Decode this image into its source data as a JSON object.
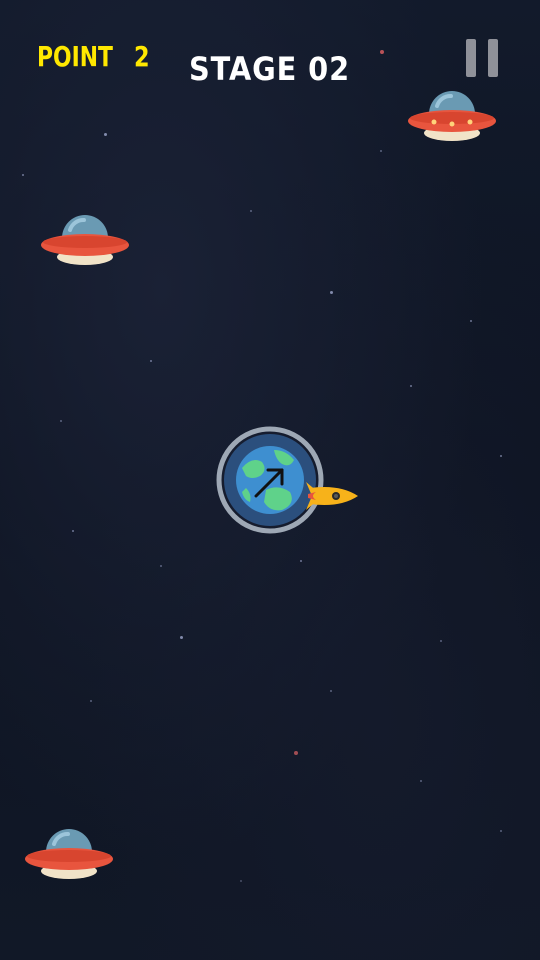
{
  "hud": {
    "point_label": "POINT",
    "point_value": "2",
    "stage_label": "STAGE 02",
    "pause_icon": "pause-icon"
  },
  "colors": {
    "point_text": "#ffe800",
    "stage_text": "#ffffff",
    "pause_icon": "#8f9199",
    "ufo_saucer": "#e8553e",
    "ufo_dome": "#6a9ab3",
    "planet_ocean": "#3e8fd0",
    "planet_land": "#5fd28a",
    "rocket": "#f7b21a"
  },
  "sprites": {
    "ufo": "ufo-icon",
    "planet": "earth-icon",
    "direction_arrow": "arrow-up-right-icon",
    "rocket": "rocket-icon"
  },
  "enemy_count": 3
}
